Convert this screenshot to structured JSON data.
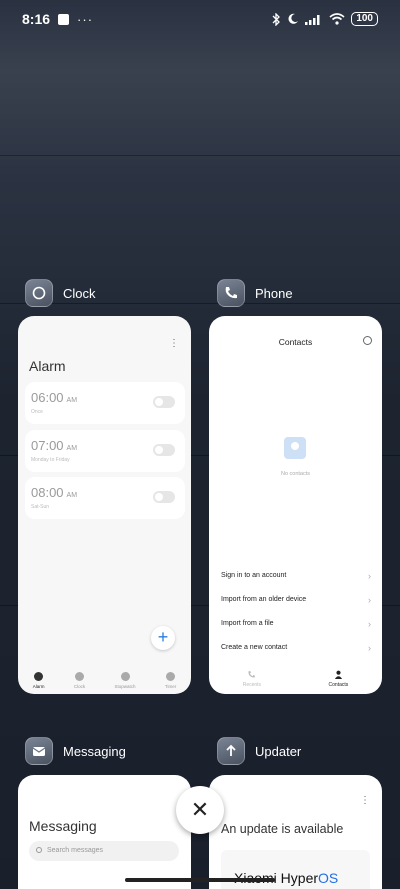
{
  "status": {
    "time": "8:16",
    "more": "···",
    "battery": "100"
  },
  "apps": [
    {
      "name": "Clock"
    },
    {
      "name": "Phone"
    },
    {
      "name": "Messaging"
    },
    {
      "name": "Updater"
    }
  ],
  "clock": {
    "menu": "⋮",
    "title": "Alarm",
    "alarms": [
      {
        "time": "06:00",
        "ampm": "AM",
        "sub": "Once"
      },
      {
        "time": "07:00",
        "ampm": "AM",
        "sub": "Monday to Friday"
      },
      {
        "time": "08:00",
        "ampm": "AM",
        "sub": "Sat-Sun"
      }
    ],
    "add": "+",
    "tabs": [
      "Alarm",
      "Clock",
      "Stopwatch",
      "Timer"
    ]
  },
  "phone": {
    "title": "Contacts",
    "empty": "No contacts",
    "options": [
      "Sign in to an account",
      "Import from an older device",
      "Import from a file",
      "Create a new contact"
    ],
    "tabs": [
      "Recents",
      "Contacts"
    ]
  },
  "messaging": {
    "title": "Messaging",
    "search_placeholder": "Search messages"
  },
  "updater": {
    "menu": "⋮",
    "title": "An update is available",
    "brand": "Xiaomi Hyper",
    "brand_os": "OS"
  },
  "close_label": "✕"
}
